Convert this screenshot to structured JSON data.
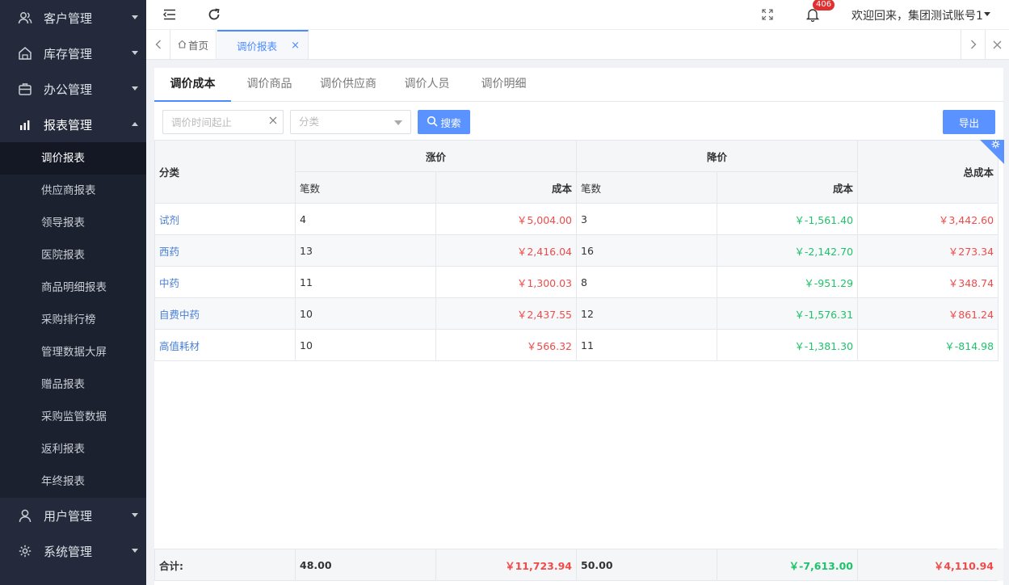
{
  "sidebar": {
    "groups_top": [
      {
        "label": "客户管理",
        "icon": "customers-icon"
      },
      {
        "label": "库存管理",
        "icon": "warehouse-icon"
      },
      {
        "label": "办公管理",
        "icon": "briefcase-icon"
      }
    ],
    "report_group": {
      "label": "报表管理",
      "icon": "bar-chart-icon"
    },
    "report_items": [
      "调价报表",
      "供应商报表",
      "领导报表",
      "医院报表",
      "商品明细报表",
      "采购排行榜",
      "管理数据大屏",
      "赠品报表",
      "采购监管数据",
      "返利报表",
      "年终报表"
    ],
    "active_item": "调价报表",
    "groups_bottom": [
      {
        "label": "用户管理",
        "icon": "user-icon"
      },
      {
        "label": "系统管理",
        "icon": "settings-icon"
      }
    ]
  },
  "topbar": {
    "notification_count": "406",
    "welcome": "欢迎回来，集团测试账号1"
  },
  "tabs": {
    "home": "首页",
    "active": "调价报表",
    "close_symbol": "×"
  },
  "subtabs": [
    "调价成本",
    "调价商品",
    "调价供应商",
    "调价人员",
    "调价明细"
  ],
  "filters": {
    "date_placeholder": "调价时间起止",
    "category_placeholder": "分类",
    "search_label": "搜索",
    "export_label": "导出"
  },
  "table": {
    "headers": {
      "category": "分类",
      "increase": "涨价",
      "decrease": "降价",
      "count": "笔数",
      "cost": "成本",
      "total_cost": "总成本"
    },
    "rows": [
      {
        "category": "试剂",
        "inc_count": "4",
        "inc_cost": "￥5,004.00",
        "dec_count": "3",
        "dec_cost": "￥-1,561.40",
        "total": "￥3,442.60",
        "total_color": "red"
      },
      {
        "category": "西药",
        "inc_count": "13",
        "inc_cost": "￥2,416.04",
        "dec_count": "16",
        "dec_cost": "￥-2,142.70",
        "total": "￥273.34",
        "total_color": "red"
      },
      {
        "category": "中药",
        "inc_count": "11",
        "inc_cost": "￥1,300.03",
        "dec_count": "8",
        "dec_cost": "￥-951.29",
        "total": "￥348.74",
        "total_color": "red"
      },
      {
        "category": "自费中药",
        "inc_count": "10",
        "inc_cost": "￥2,437.55",
        "dec_count": "12",
        "dec_cost": "￥-1,576.31",
        "total": "￥861.24",
        "total_color": "red"
      },
      {
        "category": "高值耗材",
        "inc_count": "10",
        "inc_cost": "￥566.32",
        "dec_count": "11",
        "dec_cost": "￥-1,381.30",
        "total": "￥-814.98",
        "total_color": "green"
      }
    ],
    "footer": {
      "label": "合计:",
      "inc_count": "48.00",
      "inc_cost": "￥11,723.94",
      "dec_count": "50.00",
      "dec_cost": "￥-7,613.00",
      "total": "￥4,110.94"
    }
  },
  "colors": {
    "accent": "#4a8bff",
    "sidebar_bg": "#242a3b",
    "positive": "#f04b4b",
    "negative": "#1ec36b"
  }
}
